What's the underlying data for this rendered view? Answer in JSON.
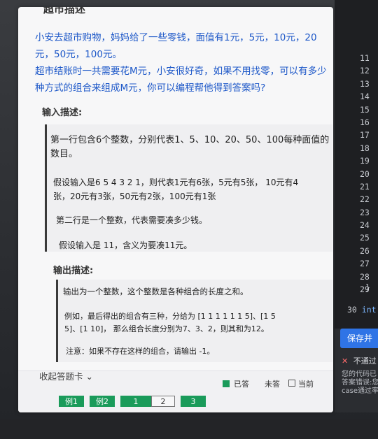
{
  "editor": {
    "line_numbers": [
      "11",
      "12",
      "13",
      "14",
      "15",
      "16",
      "17",
      "18",
      "19",
      "20",
      "21",
      "22",
      "23",
      "24",
      "25",
      "26",
      "27",
      "28",
      "29"
    ],
    "tail_text": "}",
    "last_line_number": "30",
    "last_line_code": "int"
  },
  "right_panel": {
    "save_label": "保存并",
    "fail_text": "不通过",
    "fail_message_lines": [
      "您的代码已",
      "答案错误:您",
      "case通过率"
    ]
  },
  "problem": {
    "title_fragment": "超市描述",
    "description_para1": "小安去超市购物，妈妈给了一些零钱，面值有1元，5元，10元，20元，50元，100元。",
    "description_para2": "超市结账时一共需要花M元，小安很好奇，如果不用找零，可以有多少种方式的组合来组成M元，你可以编程帮他得到答案吗?",
    "input_heading": "输入描述:",
    "input_lines": [
      "第一行包含6个整数，分别代表1、5、10、20、50、100每种面值的",
      "数目。",
      "假设输入是6  5  4  3  2  1，则代表1元有6张，5元有5张，   10元有4",
      "张，20元有3张，50元有2张，100元有1张",
      "第二行是一个整数，代表需要凑多少钱。",
      "假设输入是  11，含义为要凑11元。"
    ],
    "output_heading": "输出描述:",
    "output_lines": [
      "输出为一个整数，这个整数是各种组合的长度之和。",
      "例如，最后得出的组合有三种，分给为  [1  1  1  1  1  1  5]、[1  5",
      "5]、[1  10]，   那么组合长度分别为7、3、2，则其和为12。",
      "注意：如果不存在这样的组合，请输出  -1。"
    ]
  },
  "footer": {
    "collapse_label": "收起答题卡 ⌄",
    "legend_answered": "已答",
    "legend_unanswered": "未答",
    "legend_current": "当前",
    "buttons": [
      "例1",
      "例2",
      "1",
      "2",
      "3"
    ]
  },
  "colors": {
    "accent_blue": "#1c57c8",
    "answered_green": "#1a9b5a",
    "save_blue": "#2f74e6"
  }
}
